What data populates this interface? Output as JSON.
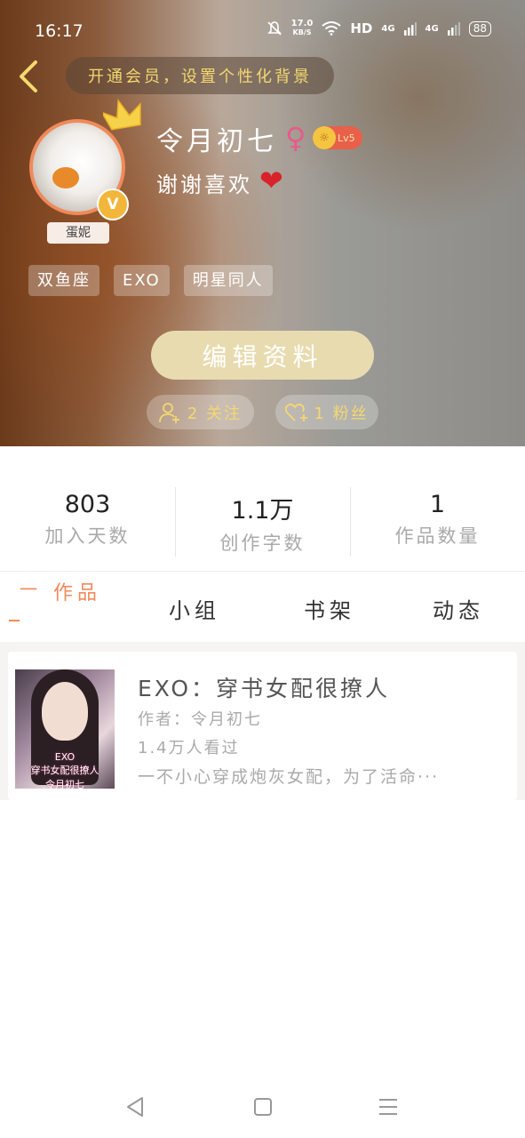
{
  "status_bar": {
    "time": "16:17",
    "net_speed_value": "17.0",
    "net_speed_unit": "KB/S",
    "hd": "HD",
    "sig1": "4G",
    "sig2": "4G",
    "battery": "88"
  },
  "header": {
    "vip_banner": "开通会员，设置个性化背景",
    "username": "令月初七",
    "gender_symbol": "♀",
    "level": "Lv5",
    "avatar_tag": "蛋妮",
    "bio": "谢谢喜欢",
    "heart": "❤",
    "verified_badge": "V",
    "tags": [
      "双鱼座",
      "EXO",
      "明星同人"
    ],
    "edit_button": "编辑资料",
    "following": "2 关注",
    "fans": "1 粉丝"
  },
  "stats": [
    {
      "value": "803",
      "label": "加入天数"
    },
    {
      "value": "1.1万",
      "label": "创作字数"
    },
    {
      "value": "1",
      "label": "作品数量"
    }
  ],
  "tabs": [
    "作品",
    "小组",
    "书架",
    "动态"
  ],
  "tab_dash": "一",
  "works": [
    {
      "title": "EXO：穿书女配很撩人",
      "author": "作者：令月初七",
      "views": "1.4万人看过",
      "description": "一不小心穿成炮灰女配，为了活命···",
      "cover_text_1": "EXO",
      "cover_text_2": "穿书女配很撩人",
      "cover_text_3": "令月初七"
    }
  ],
  "colors": {
    "accent": "#f08a5a",
    "vip_gold": "#f4d870",
    "edit_button_bg": "#e8dbb0",
    "heart_red": "#d8232a"
  },
  "icons": {
    "back": "chevron-left-icon",
    "crown": "crown-icon",
    "follow": "add-user-icon",
    "fans": "heart-plus-icon",
    "nav_back": "triangle-back-icon",
    "nav_home": "square-home-icon",
    "nav_menu": "menu-lines-icon"
  }
}
